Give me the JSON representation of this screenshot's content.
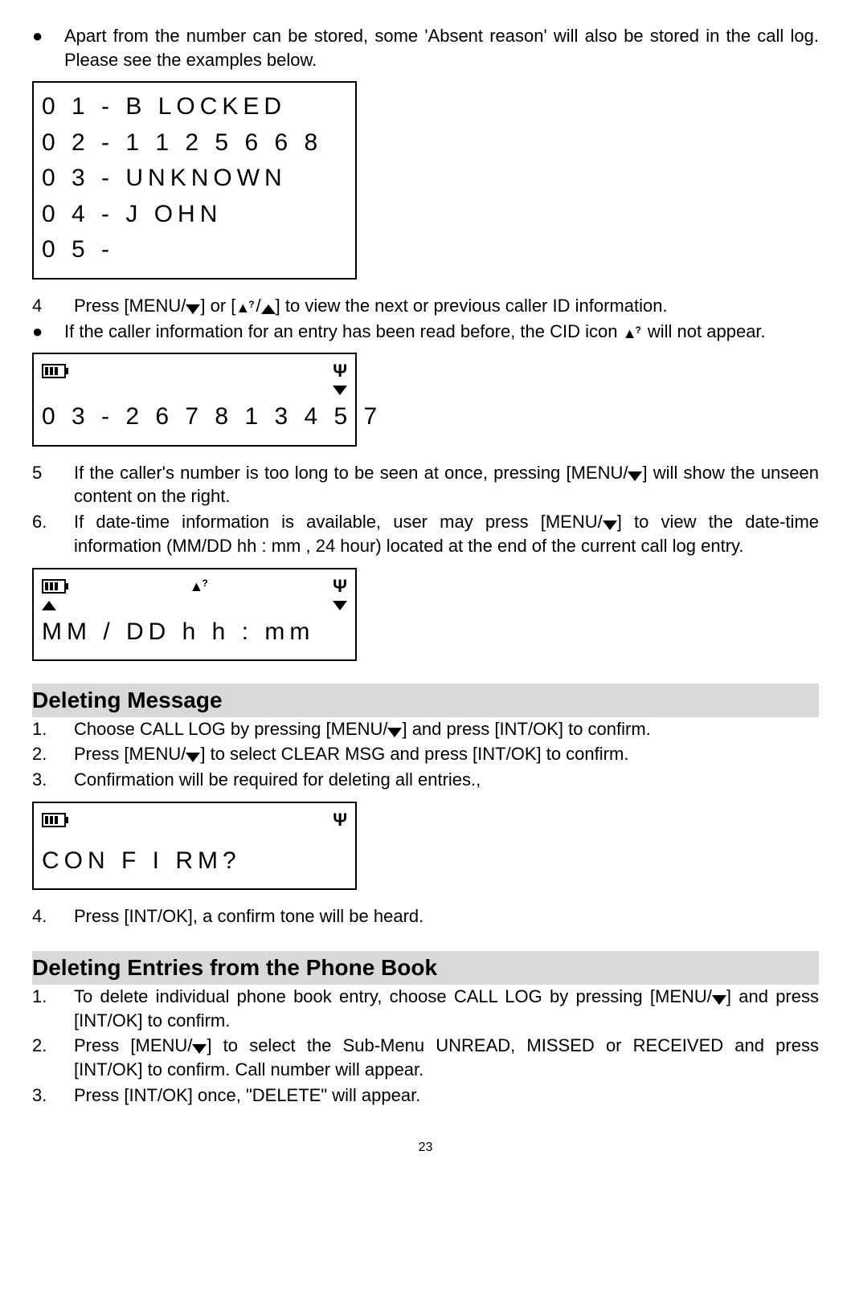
{
  "intro_bullet": "Apart from the number can be stored, some 'Absent reason' will also be stored in the call log. Please see the examples below.",
  "lcd1": {
    "lines": [
      "0 1 - B LOCKED",
      "0 2 - 1 1 2 5 6 6 8",
      "0 3 - UNKNOWN",
      "0 4 - J OHN",
      "0 5 -"
    ]
  },
  "step4": {
    "num": "4",
    "text_a": "Press [MENU/",
    "text_b": "] or [",
    "text_c": "/",
    "text_d": "] to view the next or previous caller ID information."
  },
  "bullet2": {
    "text_a": "If the caller information for an entry has been read before, the CID icon ",
    "text_b": " will not appear."
  },
  "lcd2": {
    "line": "0 3 - 2 6 7 8 1 3 4 5 7"
  },
  "step5": {
    "num": "5",
    "text_a": "If the caller's number is too long to be seen at once, pressing [MENU/",
    "text_b": "] will show the unseen content on the right."
  },
  "step6": {
    "num": "6.",
    "text_a": "If date-time information is available, user may press [MENU/",
    "text_b": "] to view the date-time information (MM/DD  hh : mm  , 24 hour) located at the end of the current call log entry."
  },
  "lcd3": {
    "line": "MM / DD   h h : mm"
  },
  "heading1": "Deleting Message",
  "dm": {
    "s1": {
      "num": "1.",
      "text_a": "Choose CALL LOG by pressing [MENU/",
      "text_b": "] and press [INT/OK] to confirm."
    },
    "s2": {
      "num": "2.",
      "text_a": "Press [MENU/",
      "text_b": "] to select CLEAR MSG and press [INT/OK] to confirm."
    },
    "s3": {
      "num": "3.",
      "text": "Confirmation will be required for deleting all entries.,"
    },
    "s4": {
      "num": "4.",
      "text": "Press [INT/OK], a confirm tone will be heard."
    }
  },
  "lcd4": {
    "line": "  CON F I RM?"
  },
  "heading2": "Deleting Entries from the Phone Book",
  "de": {
    "s1": {
      "num": "1.",
      "text_a": "To delete individual phone book entry, choose CALL LOG by pressing [MENU/",
      "text_b": "] and press [INT/OK] to confirm."
    },
    "s2": {
      "num": "2.",
      "text_a": "Press [MENU/",
      "text_b": "] to select the Sub-Menu UNREAD, MISSED or RECEIVED and press [INT/OK] to confirm.  Call number will appear."
    },
    "s3": {
      "num": "3.",
      "text": "Press [INT/OK] once, \"DELETE\" will appear."
    }
  },
  "page_number": "23"
}
